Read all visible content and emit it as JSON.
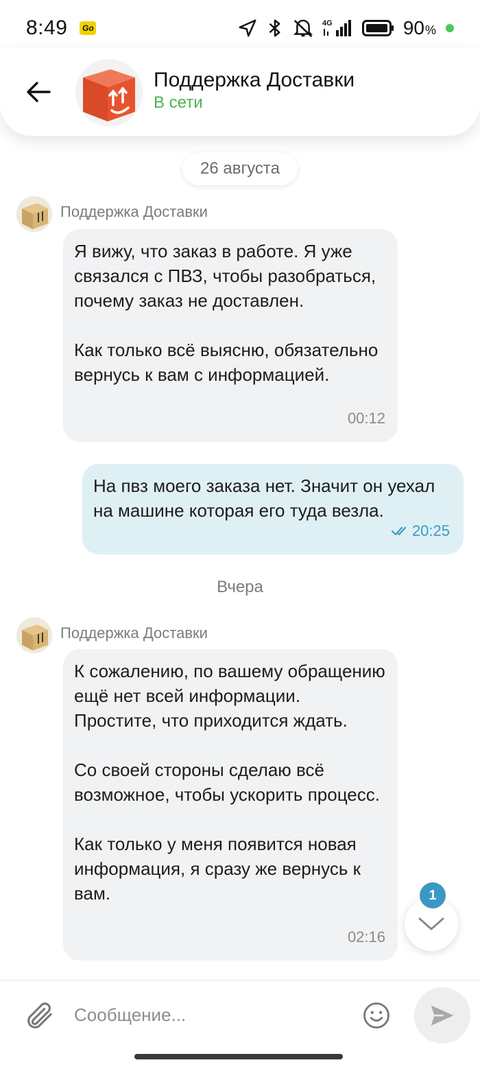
{
  "status_bar": {
    "time": "8:49",
    "app_icon_label": "Go",
    "network": "4G",
    "battery_percent": "90",
    "battery_unit": "%",
    "icons": [
      "location-icon",
      "bluetooth-icon",
      "mute-icon",
      "signal-icon",
      "battery-icon"
    ]
  },
  "header": {
    "title": "Поддержка Доставки",
    "status": "В сети",
    "status_color": "#4bb44d"
  },
  "chat": {
    "dates": {
      "first": "26 августа",
      "second": "Вчера"
    },
    "messages": [
      {
        "direction": "incoming",
        "sender": "Поддержка Доставки",
        "text": "Я вижу, что заказ в работе. Я уже связался с ПВЗ, чтобы разобраться, почему заказ не доставлен.\n\nКак только всё выясню, обязательно вернусь к вам с информацией.",
        "time": "00:12"
      },
      {
        "direction": "outgoing",
        "text": "На пвз моего заказа нет. Значит он уехал на машине которая его туда везла.",
        "time": "20:25",
        "read": true
      },
      {
        "direction": "incoming",
        "sender": "Поддержка Доставки",
        "text": "К сожалению, по вашему обращению ещё нет всей информации. Простите, что приходится ждать.\n\nСо своей стороны сделаю всё возможное, чтобы ускорить процесс.\n\nКак только у меня появится новая информация, я сразу же вернусь к вам.",
        "time": "02:16"
      }
    ],
    "unread_count": "1"
  },
  "composer": {
    "placeholder": "Сообщение..."
  },
  "colors": {
    "incoming_bubble": "#f1f2f4",
    "outgoing_bubble": "#dff0f4",
    "accent": "#3b97c4",
    "brand": "#e8532f"
  }
}
